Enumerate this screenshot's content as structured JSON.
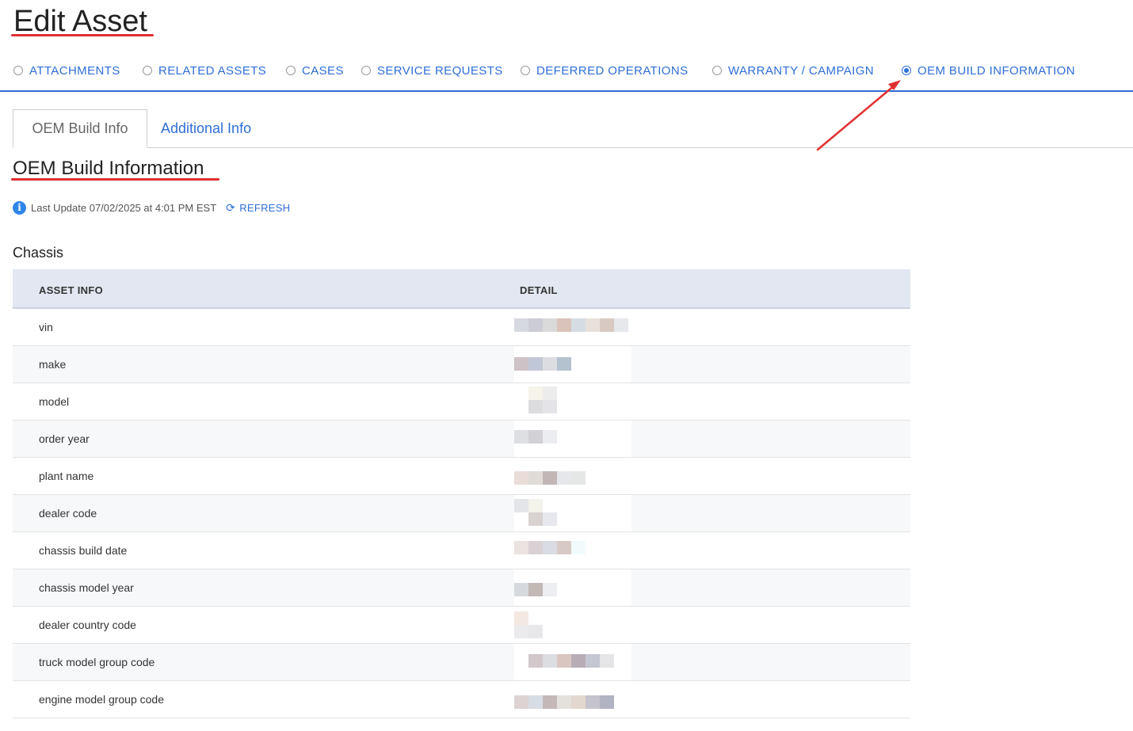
{
  "page": {
    "title": "Edit Asset"
  },
  "radio_nav": {
    "items": [
      {
        "label": "ATTACHMENTS",
        "checked": false
      },
      {
        "label": "RELATED ASSETS",
        "checked": false
      },
      {
        "label": "CASES",
        "checked": false
      },
      {
        "label": "SERVICE REQUESTS",
        "checked": false
      },
      {
        "label": "DEFERRED OPERATIONS",
        "checked": false
      },
      {
        "label": "WARRANTY / CAMPAIGN",
        "checked": false
      },
      {
        "label": "OEM BUILD INFORMATION",
        "checked": true
      }
    ]
  },
  "tabs": {
    "active": "OEM Build Info",
    "other": "Additional Info"
  },
  "section": {
    "title": "OEM Build Information",
    "last_update": "Last Update 07/02/2025 at 4:01 PM EST",
    "refresh_label": "REFRESH"
  },
  "chassis": {
    "title": "Chassis",
    "headers": {
      "asset_info": "ASSET INFO",
      "detail": "DETAIL"
    },
    "rows": [
      {
        "label": "vin",
        "detail": ""
      },
      {
        "label": "make",
        "detail": ""
      },
      {
        "label": "model",
        "detail": ""
      },
      {
        "label": "order year",
        "detail": ""
      },
      {
        "label": "plant name",
        "detail": ""
      },
      {
        "label": "dealer code",
        "detail": ""
      },
      {
        "label": "chassis build date",
        "detail": ""
      },
      {
        "label": "chassis model year",
        "detail": ""
      },
      {
        "label": "dealer country code",
        "detail": ""
      },
      {
        "label": "truck model group code",
        "detail": ""
      },
      {
        "label": "engine model group code",
        "detail": ""
      }
    ]
  },
  "colors": {
    "accent": "#2f6fd6",
    "annotation": "#e03030",
    "header_bg": "#e2e7f1"
  }
}
